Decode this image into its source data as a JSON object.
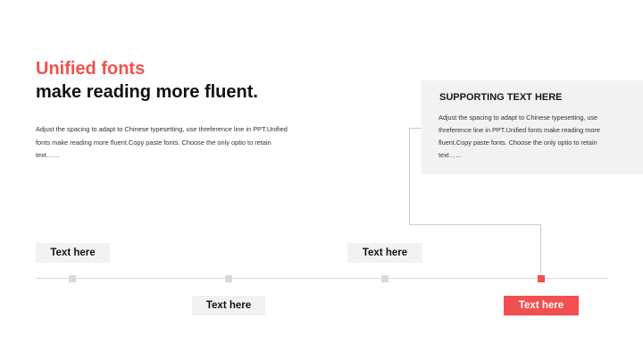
{
  "header": {
    "accent_title": "Unified fonts",
    "main_title": "make reading more fluent.",
    "body": "Adjust the spacing to adapt to Chinese typesetting, use threference line in PPT.Unified fonts make reading more fluent.Copy paste fonts. Choose the only optio to retain text……"
  },
  "support": {
    "title": "SUPPORTING TEXT HERE",
    "body": "Adjust the spacing to adapt to Chinese typesetting, use threference line in PPT.Unified fonts make reading more fluent.Copy paste fonts. Choose the only optio to retain text……"
  },
  "timeline": {
    "labels": [
      "Text here",
      "Text here",
      "Text here",
      "Text here"
    ]
  },
  "colors": {
    "accent": "#f25050",
    "panel": "#f2f2f2",
    "line": "#d9d9d9"
  }
}
